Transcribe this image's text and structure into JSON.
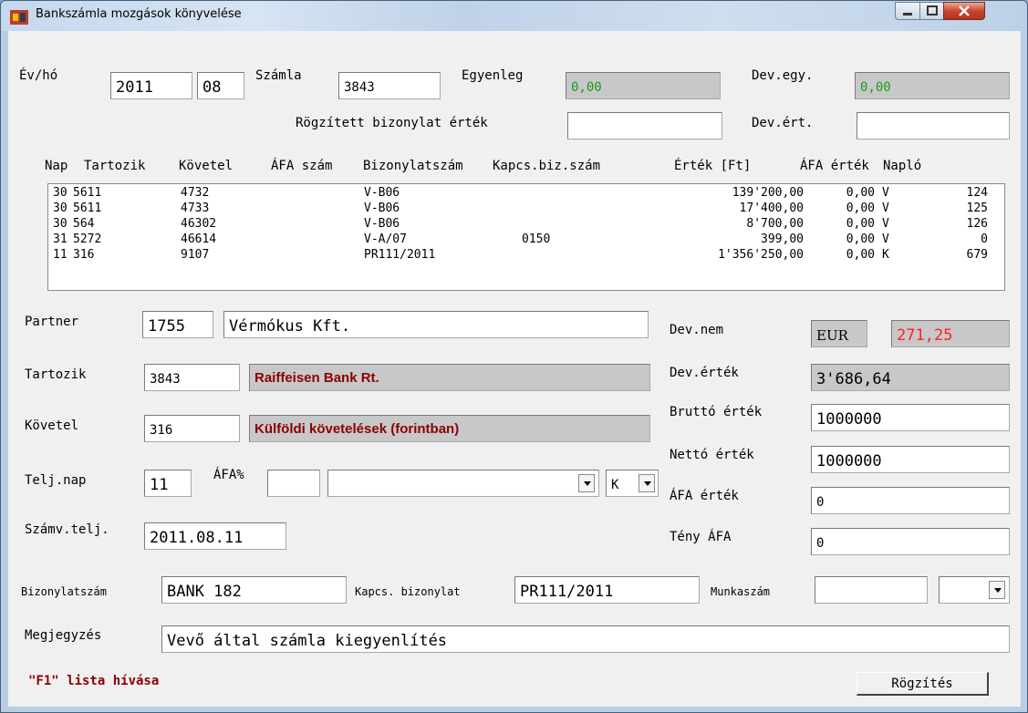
{
  "window": {
    "title": "Bankszámla mozgások könyvelése"
  },
  "header": {
    "ev_ho_label": "Év/hó",
    "year": "2011",
    "month": "08",
    "szamla_label": "Számla",
    "szamla": "3843",
    "egyenleg_label": "Egyenleg",
    "egyenleg": "0,00",
    "devegy_label": "Dev.egy.",
    "devegy": "0,00",
    "rogzitett_label": "Rögzített bizonylat érték",
    "rogzitett": "",
    "devert_label": "Dev.ért.",
    "devert": ""
  },
  "grid": {
    "columns": [
      "Nap",
      "Tartozik",
      "Követel",
      "ÁFA szám",
      "Bizonylatszám",
      "Kapcs.biz.szám",
      "Érték [Ft]",
      "ÁFA érték",
      "Napló"
    ],
    "rows": [
      {
        "nap": "30",
        "tartozik": "5611",
        "kovetel": "4732",
        "afaszam": "",
        "biz": "V-B06",
        "kapcs": "",
        "ertek": "139'200,00",
        "afaertek": "0,00",
        "flag": "V",
        "naplo": "124"
      },
      {
        "nap": "30",
        "tartozik": "5611",
        "kovetel": "4733",
        "afaszam": "",
        "biz": "V-B06",
        "kapcs": "",
        "ertek": "17'400,00",
        "afaertek": "0,00",
        "flag": "V",
        "naplo": "125"
      },
      {
        "nap": "30",
        "tartozik": "564",
        "kovetel": "46302",
        "afaszam": "",
        "biz": "V-B06",
        "kapcs": "",
        "ertek": "8'700,00",
        "afaertek": "0,00",
        "flag": "V",
        "naplo": "126"
      },
      {
        "nap": "31",
        "tartozik": "5272",
        "kovetel": "46614",
        "afaszam": "",
        "biz": "V-A/07",
        "kapcs": "0150",
        "ertek": "399,00",
        "afaertek": "0,00",
        "flag": "V",
        "naplo": "0"
      },
      {
        "nap": "11",
        "tartozik": "316",
        "kovetel": "9107",
        "afaszam": "",
        "biz": "PR111/2011",
        "kapcs": "",
        "ertek": "1'356'250,00",
        "afaertek": "0,00",
        "flag": "K",
        "naplo": "679"
      }
    ]
  },
  "form": {
    "partner_label": "Partner",
    "partner_code": "1755",
    "partner_name": "Vérmókus Kft.",
    "tartozik_label": "Tartozik",
    "tartozik": "3843",
    "tartozik_desc": "Raiffeisen Bank Rt.",
    "kovetel_label": "Követel",
    "kovetel": "316",
    "kovetel_desc": "Külföldi követelések (forintban)",
    "teljnap_label": "Telj.nap",
    "teljnap": "11",
    "afa_label": "ÁFA%",
    "afa": "",
    "afa_select": "",
    "kind_select": "K",
    "szamvtelj_label": "Számv.telj.",
    "szamvtelj": "2011.08.11",
    "devnem_label": "Dev.nem",
    "devnem": "EUR",
    "arfolyam": "271,25",
    "devertek_label": "Dev.érték",
    "devertek": "3'686,64",
    "brutto_label": "Bruttó érték",
    "brutto": "1000000",
    "netto_label": "Nettó érték",
    "netto": "1000000",
    "afaertek_label": "ÁFA érték",
    "afaertek": "0",
    "tenyafa_label": "Tény ÁFA",
    "tenyafa": "0",
    "bizonylatszam_label": "Bizonylatszám",
    "bizonylatszam": "BANK 182",
    "kapcs_label": "Kapcs. bizonylat",
    "kapcs": "PR111/2011",
    "munkaszam_label": "Munkaszám",
    "munkaszam": "",
    "munkaszam_select": "",
    "megjegyzes_label": "Megjegyzés",
    "megjegyzes": "Vevő által számla kiegyenlítés"
  },
  "footer": {
    "hint": "\"F1\" lista hívása",
    "save_label": "Rögzítés"
  },
  "colors": {
    "desc_text": "#8b0000",
    "rate_text": "#ff2020",
    "balance_text": "#1a9a1a"
  }
}
